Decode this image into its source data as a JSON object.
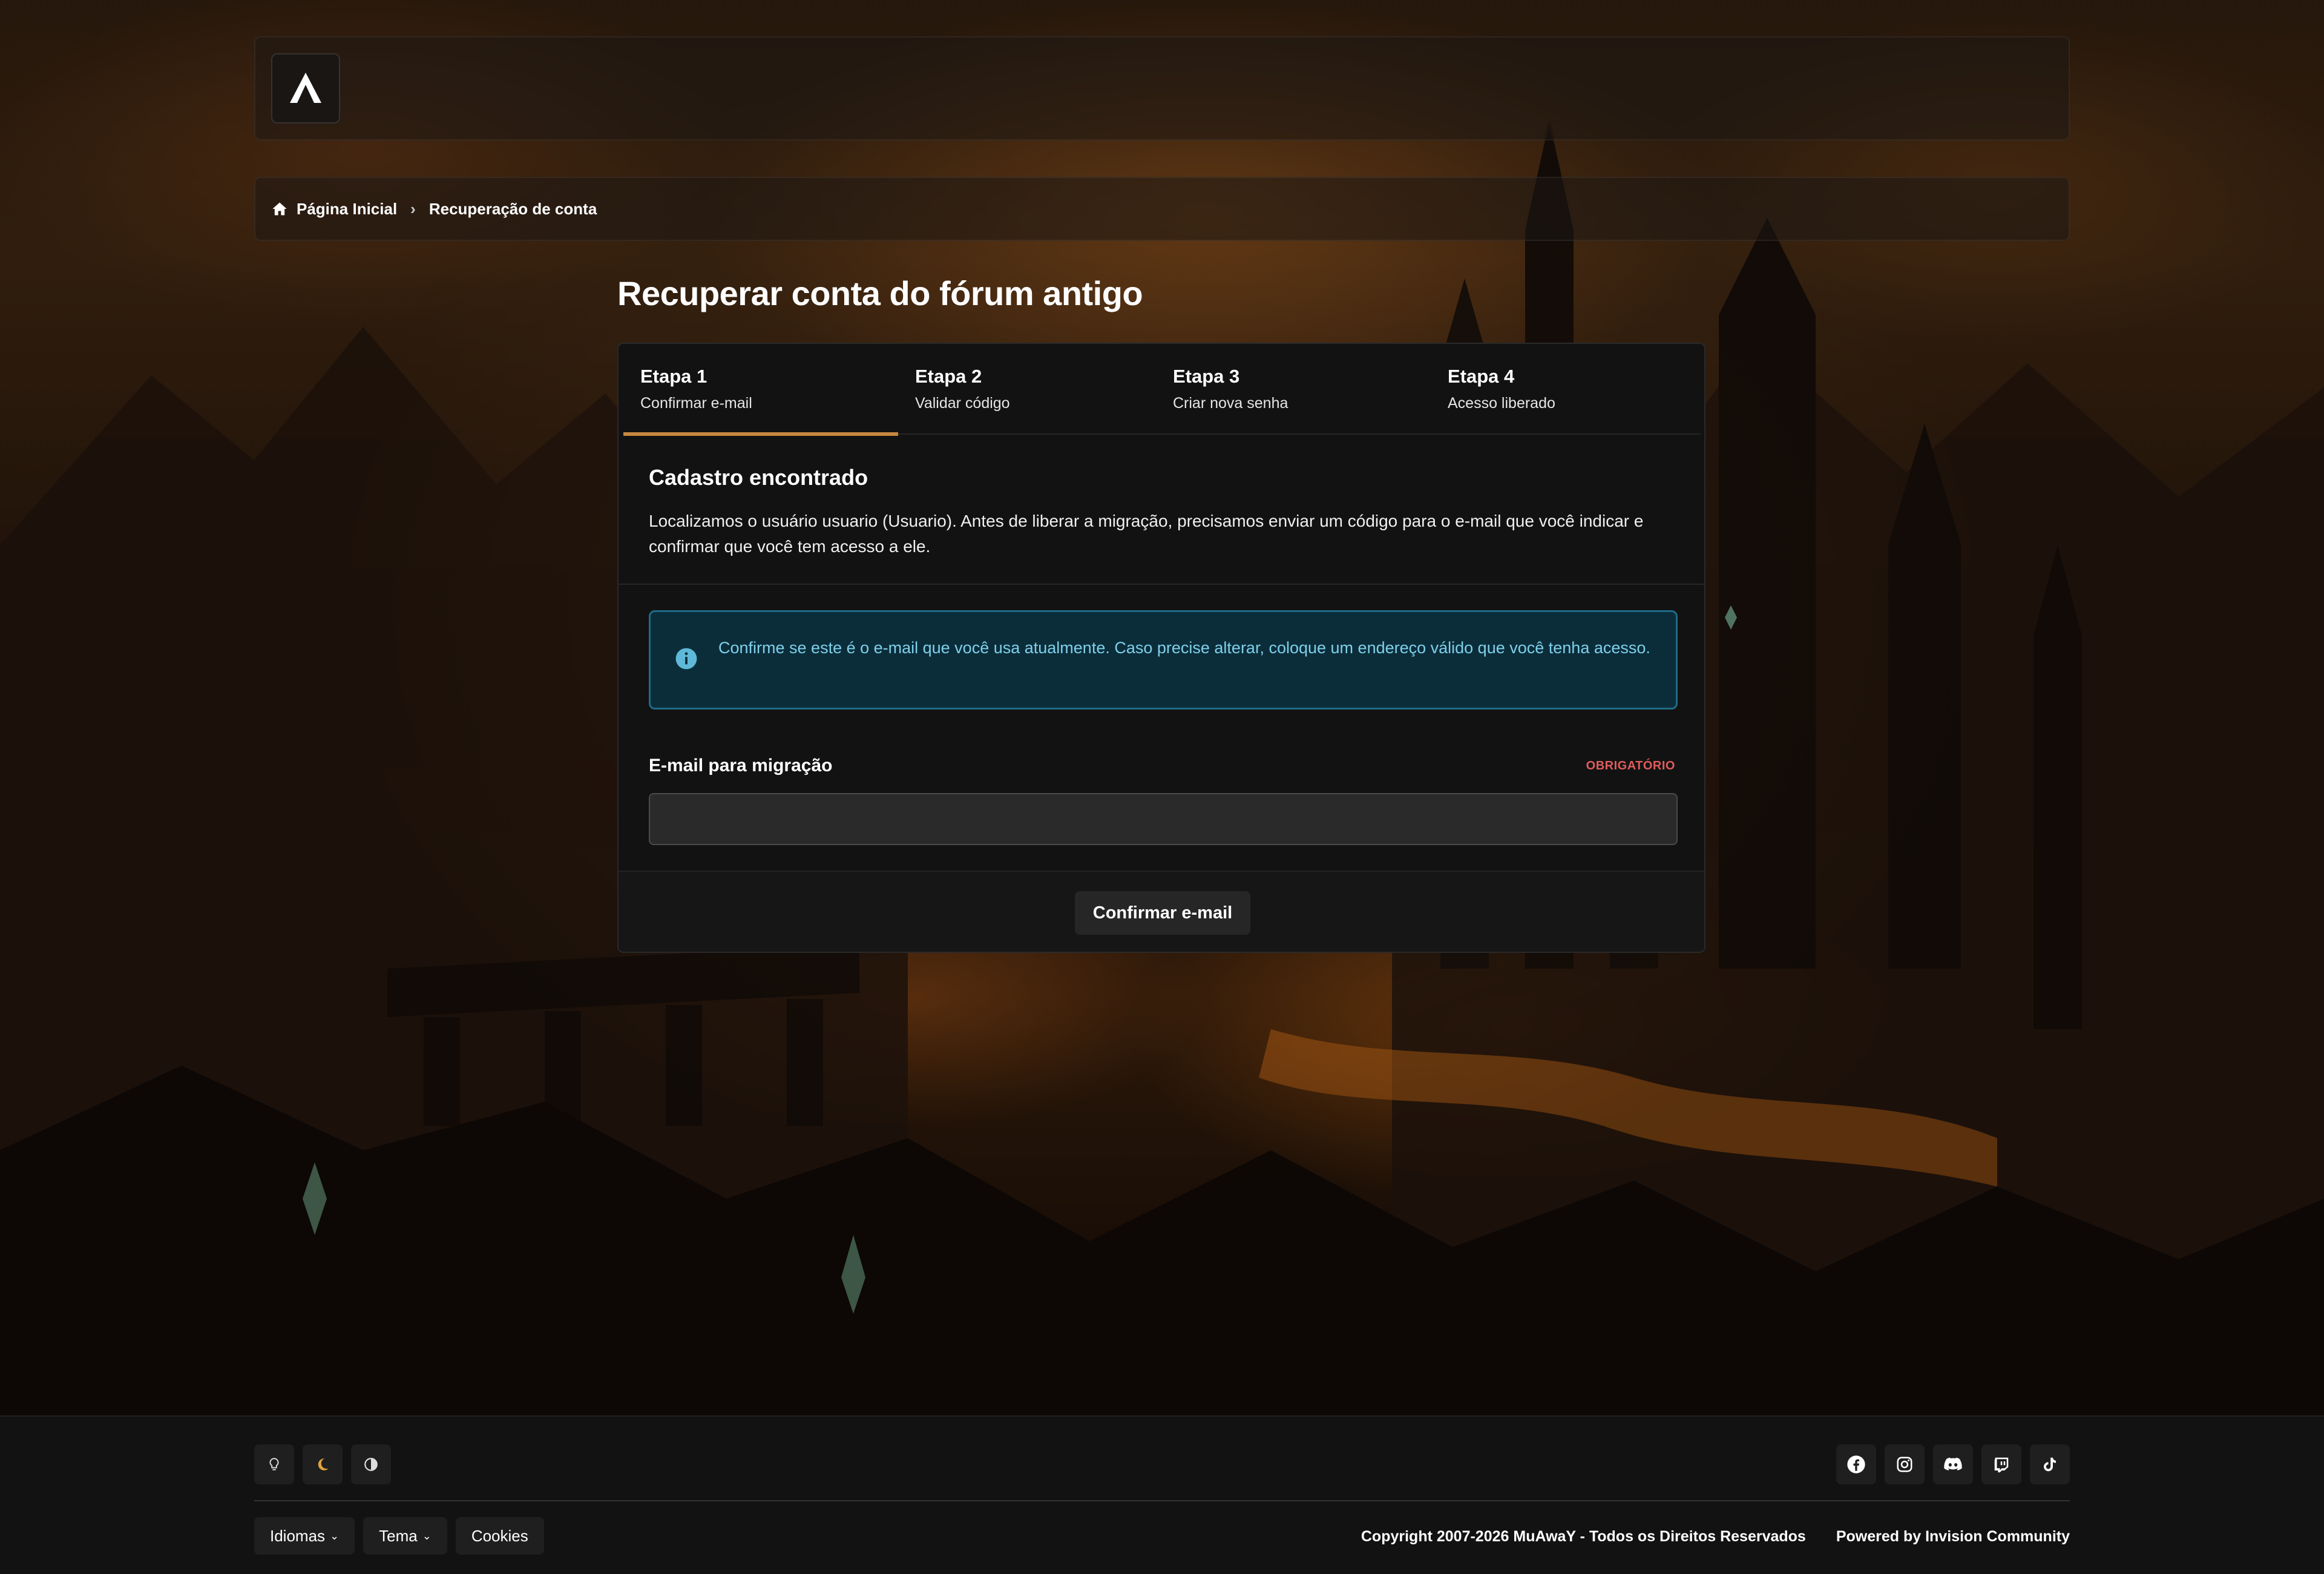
{
  "breadcrumb": {
    "home": "Página Inicial",
    "current": "Recuperação de conta"
  },
  "page": {
    "title": "Recuperar conta do fórum antigo"
  },
  "steps": [
    {
      "title": "Etapa 1",
      "subtitle": "Confirmar e-mail",
      "active": true
    },
    {
      "title": "Etapa 2",
      "subtitle": "Validar código",
      "active": false
    },
    {
      "title": "Etapa 3",
      "subtitle": "Criar nova senha",
      "active": false
    },
    {
      "title": "Etapa 4",
      "subtitle": "Acesso liberado",
      "active": false
    }
  ],
  "found": {
    "title": "Cadastro encontrado",
    "text": "Localizamos o usuário usuario (Usuario). Antes de liberar a migração, precisamos enviar um código para o e-mail que você indicar e confirmar que você tem acesso a ele."
  },
  "alert": {
    "icon": "info-icon",
    "text": "Confirme se este é o e-mail que você usa atualmente. Caso precise alterar, coloque um endereço válido que você tenha acesso."
  },
  "form": {
    "email_label": "E-mail para migração",
    "required_label": "OBRIGATÓRIO",
    "email_value": "",
    "submit_label": "Confirmar e-mail"
  },
  "footer": {
    "theme_icons": [
      "lightbulb-icon",
      "moon-icon",
      "contrast-icon"
    ],
    "social_icons": [
      "facebook-icon",
      "instagram-icon",
      "discord-icon",
      "twitch-icon",
      "tiktok-icon"
    ],
    "links": {
      "languages": "Idiomas",
      "theme": "Tema",
      "cookies": "Cookies"
    },
    "copyright": "Copyright 2007-2026 MuAwaY - Todos os Direitos Reservados",
    "powered": "Powered by Invision Community"
  },
  "colors": {
    "accent": "#c9873f",
    "alert_bg": "#0b2d3a",
    "alert_text": "#7fd0ea",
    "required": "#e05c5c",
    "active_moon": "#e0a23c"
  }
}
